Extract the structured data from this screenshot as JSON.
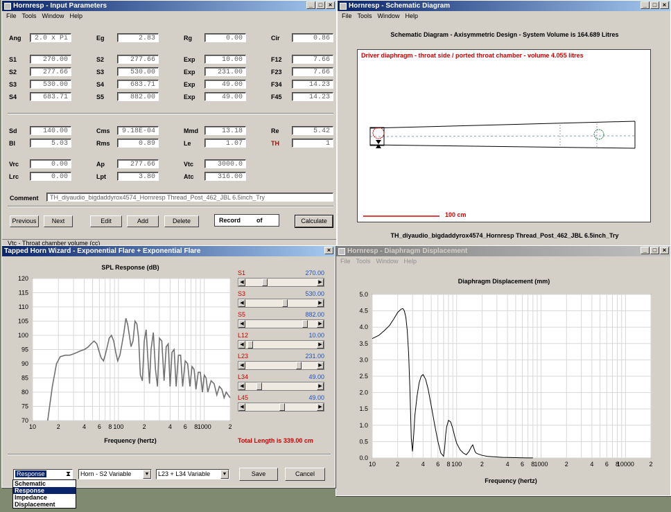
{
  "input_params": {
    "title": "Hornresp - Input Parameters",
    "menu": [
      "File",
      "Tools",
      "Window",
      "Help"
    ],
    "rows1": [
      [
        {
          "l": "Ang",
          "v": "2.0 x Pi"
        },
        {
          "l": "Eg",
          "v": "2.83"
        },
        {
          "l": "Rg",
          "v": "0.00"
        },
        {
          "l": "Cir",
          "v": "0.86"
        }
      ],
      [
        {
          "l": "S1",
          "v": "270.00"
        },
        {
          "l": "S2",
          "v": "277.66"
        },
        {
          "l": "Exp",
          "v": "10.00"
        },
        {
          "l": "F12",
          "v": "7.66"
        }
      ],
      [
        {
          "l": "S2",
          "v": "277.66"
        },
        {
          "l": "S3",
          "v": "530.00"
        },
        {
          "l": "Exp",
          "v": "231.00"
        },
        {
          "l": "F23",
          "v": "7.66"
        }
      ],
      [
        {
          "l": "S3",
          "v": "530.00"
        },
        {
          "l": "S4",
          "v": "683.71"
        },
        {
          "l": "Exp",
          "v": "49.00"
        },
        {
          "l": "F34",
          "v": "14.23"
        }
      ],
      [
        {
          "l": "S4",
          "v": "683.71"
        },
        {
          "l": "S5",
          "v": "882.00"
        },
        {
          "l": "Exp",
          "v": "49.00"
        },
        {
          "l": "F45",
          "v": "14.23"
        }
      ]
    ],
    "rows2": [
      [
        {
          "l": "Sd",
          "v": "140.00"
        },
        {
          "l": "Cms",
          "v": "9.18E-04"
        },
        {
          "l": "Mmd",
          "v": "13.18"
        },
        {
          "l": "Re",
          "v": "5.42"
        }
      ],
      [
        {
          "l": "Bl",
          "v": "5.03"
        },
        {
          "l": "Rms",
          "v": "0.89"
        },
        {
          "l": "Le",
          "v": "1.07"
        },
        {
          "l": "TH",
          "v": "1"
        }
      ]
    ],
    "rows3": [
      [
        {
          "l": "Vrc",
          "v": "0.00"
        },
        {
          "l": "Ap",
          "v": "277.66"
        },
        {
          "l": "Vtc",
          "v": "3000.0"
        }
      ],
      [
        {
          "l": "Lrc",
          "v": "0.00"
        },
        {
          "l": "Lpt",
          "v": "3.80"
        },
        {
          "l": "Atc",
          "v": "316.00"
        }
      ]
    ],
    "comment_label": "Comment",
    "comment_value": "TH_diyaudio_bigdaddyrox4574_Hornresp Thread_Post_462_JBL 6.5inch_Try",
    "buttons": {
      "previous": "Previous",
      "next": "Next",
      "edit": "Edit",
      "add": "Add",
      "delete": "Delete",
      "record": "Record",
      "of": "of",
      "calculate": "Calculate"
    },
    "status": "Vtc - Throat chamber volume (cc)"
  },
  "schematic": {
    "title": "Hornresp - Schematic Diagram",
    "menu": [
      "File",
      "Tools",
      "Window",
      "Help"
    ],
    "heading": "Schematic Diagram - Axisymmetric Design - System Volume is 164.689 Litres",
    "note": "Driver diaphragm - throat side / ported throat chamber - volume 4.055 litres",
    "scale": "100 cm",
    "footer": "TH_diyaudio_bigdaddyrox4574_Hornresp Thread_Post_462_JBL 6.5inch_Try"
  },
  "wizard": {
    "title": "Tapped Horn Wizard - Exponential Flare + Exponential Flare",
    "chart_title": "SPL Response (dB)",
    "xlabel": "Frequency (hertz)",
    "total_length": "Total Length is 339.00 cm",
    "sliders": [
      {
        "name": "S1",
        "value": "270.00",
        "pos": 0.25
      },
      {
        "name": "S3",
        "value": "530.00",
        "pos": 0.55
      },
      {
        "name": "S5",
        "value": "882.00",
        "pos": 0.85
      },
      {
        "name": "L12",
        "value": "10.00",
        "pos": 0.03
      },
      {
        "name": "L23",
        "value": "231.00",
        "pos": 0.75
      },
      {
        "name": "L34",
        "value": "49.00",
        "pos": 0.16
      },
      {
        "name": "L45",
        "value": "49.00",
        "pos": 0.5
      }
    ],
    "combo1": "Response",
    "combo2": "Horn - S2 Variable",
    "combo3": "L23 + L34 Variable",
    "save": "Save",
    "cancel": "Cancel",
    "dropdown_items": [
      "Schematic",
      "Response",
      "Impedance",
      "Displacement"
    ],
    "dropdown_selected": 1
  },
  "displacement": {
    "title": "Hornresp - Diaphragm Displacement",
    "menu": [
      "File",
      "Tools",
      "Window",
      "Help"
    ],
    "chart_title": "Diaphragm Displacement (mm)",
    "xlabel": "Frequency (hertz)"
  },
  "chart_data": [
    {
      "type": "line",
      "title": "SPL Response (dB)",
      "xlabel": "Frequency (hertz)",
      "ylabel": "",
      "xscale": "log",
      "xlim": [
        10,
        2000
      ],
      "ylim": [
        70,
        120
      ],
      "yticks": [
        70,
        75,
        80,
        85,
        90,
        95,
        100,
        105,
        110,
        115,
        120
      ],
      "xtick_labels": [
        "10",
        "2",
        "4",
        "6",
        "8",
        "100",
        "2",
        "4",
        "6",
        "8",
        "1000",
        "2"
      ],
      "grid": true,
      "x": [
        15,
        17,
        19,
        21,
        24,
        27,
        30,
        33,
        36,
        40,
        44,
        48,
        52,
        56,
        60,
        63,
        67,
        70,
        74,
        78,
        83,
        88,
        93,
        98,
        104,
        110,
        116,
        122,
        128,
        134,
        140,
        148,
        156,
        164,
        172,
        180,
        190,
        200,
        210,
        220,
        230,
        240,
        255,
        270,
        285,
        300,
        320,
        340,
        360,
        380,
        400,
        420,
        445,
        470,
        500,
        530,
        560,
        600,
        640,
        680,
        720,
        760,
        800,
        850,
        900,
        950,
        1000,
        1050,
        1100,
        1200,
        1300,
        1400,
        1500,
        1600,
        1700,
        1800,
        1900,
        2000
      ],
      "y": [
        70,
        82,
        90,
        92.5,
        93,
        93,
        93.5,
        94,
        94.5,
        95,
        95.8,
        97,
        98,
        97,
        94,
        92,
        91,
        93,
        96,
        99,
        100,
        98,
        94,
        91,
        93,
        97,
        101,
        106,
        104,
        100,
        96,
        98,
        105,
        104,
        99,
        86,
        84,
        98,
        102,
        92,
        83,
        95,
        101,
        88,
        82,
        99,
        98,
        84,
        96,
        97,
        82,
        94,
        95,
        82,
        93,
        93,
        82,
        91,
        90,
        82,
        89,
        88,
        81,
        87,
        87,
        80,
        86,
        85,
        80,
        84,
        83,
        79,
        82,
        81,
        78,
        80,
        79,
        78
      ]
    },
    {
      "type": "line",
      "title": "Diaphragm Displacement (mm)",
      "xlabel": "Frequency (hertz)",
      "ylabel": "",
      "xscale": "log",
      "xlim": [
        10,
        20000
      ],
      "ylim": [
        0,
        5
      ],
      "yticks": [
        0.0,
        0.5,
        1.0,
        1.5,
        2.0,
        2.5,
        3.0,
        3.5,
        4.0,
        4.5,
        5.0
      ],
      "xtick_labels": [
        "10",
        "2",
        "4",
        "6",
        "8",
        "100",
        "2",
        "4",
        "6",
        "8",
        "1000",
        "2",
        "4",
        "6",
        "8",
        "10000",
        "2"
      ],
      "grid": true,
      "x": [
        10,
        12,
        14,
        16,
        18,
        20,
        22,
        23,
        24,
        25,
        26,
        27,
        28,
        29,
        30,
        31,
        32,
        34,
        36,
        38,
        40,
        43,
        46,
        50,
        55,
        60,
        65,
        70,
        72,
        74,
        76,
        80,
        85,
        90,
        95,
        100,
        110,
        120,
        130,
        140,
        150,
        155,
        160,
        165,
        170,
        180,
        200,
        230,
        260,
        300,
        350,
        400,
        500,
        600,
        700,
        800
      ],
      "y": [
        3.65,
        3.75,
        3.9,
        4.05,
        4.25,
        4.45,
        4.55,
        4.57,
        4.5,
        4.3,
        3.9,
        3.2,
        2.0,
        0.6,
        0.2,
        0.7,
        1.3,
        1.9,
        2.3,
        2.5,
        2.55,
        2.4,
        2.1,
        1.6,
        1.0,
        0.5,
        0.15,
        0.05,
        0.3,
        0.7,
        0.95,
        1.15,
        1.1,
        0.9,
        0.65,
        0.45,
        0.25,
        0.15,
        0.1,
        0.2,
        0.35,
        0.4,
        0.3,
        0.2,
        0.15,
        0.12,
        0.08,
        0.05,
        0.04,
        0.03,
        0.02,
        0.015,
        0.01,
        0.005,
        0.003,
        0.002
      ]
    }
  ]
}
